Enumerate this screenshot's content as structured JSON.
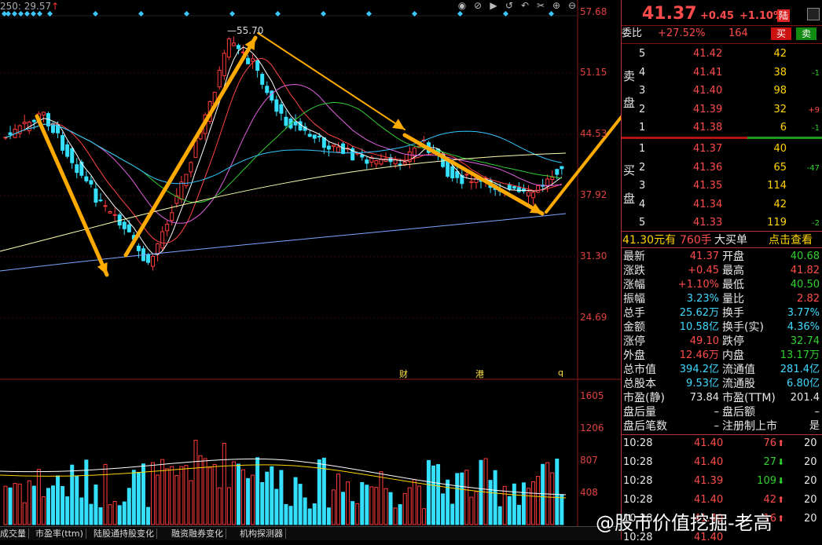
{
  "chart_header": {
    "ma_text": "250: 29.57",
    "peak_label": "55.70"
  },
  "price_axis": [
    "57.68",
    "51.15",
    "44.53",
    "37.92",
    "31.30",
    "24.69"
  ],
  "volume_axis": [
    "1605",
    "1206",
    "807",
    "408"
  ],
  "event_markers": [
    "财",
    "港",
    "q"
  ],
  "toolbar_icons": [
    "eye-icon",
    "eye-slash-icon",
    "play-icon",
    "replay-icon",
    "undo-icon",
    "settings-icon",
    "zoom-in-icon",
    "zoom-out-icon"
  ],
  "bottom_tabs": [
    "成交量",
    "市盈率(ttm)",
    "陆股通持股变化",
    "融资融券变化",
    "机构探测器"
  ],
  "watermark": "@股市价值挖掘-老高",
  "colors": {
    "up": "#ff3b3b",
    "down": "#35e0ff",
    "bg": "#000000",
    "arrow": "#ffaa00"
  },
  "quote": {
    "price": "41.37",
    "change": "+0.45",
    "change_pct": "+1.10%",
    "tag": "陆",
    "weibi_label": "委比",
    "weibi_value": "+27.52%",
    "weicha": "164",
    "sell_button": "买",
    "buy_button": "卖",
    "sell_side_label": [
      "卖",
      "盘"
    ],
    "buy_side_label": [
      "买",
      "盘"
    ],
    "asks": [
      {
        "level": "5",
        "price": "41.42",
        "vol": "42",
        "delta": ""
      },
      {
        "level": "4",
        "price": "41.41",
        "vol": "38",
        "delta": "-1"
      },
      {
        "level": "3",
        "price": "41.40",
        "vol": "98",
        "delta": ""
      },
      {
        "level": "2",
        "price": "41.39",
        "vol": "32",
        "delta": "+9"
      },
      {
        "level": "1",
        "price": "41.38",
        "vol": "6",
        "delta": "-1"
      }
    ],
    "bids": [
      {
        "level": "1",
        "price": "41.37",
        "vol": "40",
        "delta": ""
      },
      {
        "level": "2",
        "price": "41.36",
        "vol": "65",
        "delta": "-47"
      },
      {
        "level": "3",
        "price": "41.35",
        "vol": "114",
        "delta": ""
      },
      {
        "level": "4",
        "price": "41.34",
        "vol": "42",
        "delta": ""
      },
      {
        "level": "5",
        "price": "41.33",
        "vol": "119",
        "delta": "-2"
      }
    ],
    "big_order": {
      "price": "41.30元有",
      "qty": "760手",
      "label": "大买单",
      "link": "点击查看"
    },
    "stats": [
      {
        "l1": "最新",
        "v1": "41.37",
        "c1": "red",
        "l2": "开盘",
        "v2": "40.68",
        "c2": "green"
      },
      {
        "l1": "涨跌",
        "v1": "+0.45",
        "c1": "red",
        "l2": "最高",
        "v2": "41.82",
        "c2": "red"
      },
      {
        "l1": "涨幅",
        "v1": "+1.10%",
        "c1": "red",
        "l2": "最低",
        "v2": "40.50",
        "c2": "green"
      },
      {
        "l1": "振幅",
        "v1": "3.23%",
        "c1": "cyan",
        "l2": "量比",
        "v2": "2.82",
        "c2": "red"
      },
      {
        "l1": "总手",
        "v1": "25.62万",
        "c1": "cyan",
        "l2": "换手",
        "v2": "3.77%",
        "c2": "cyan"
      },
      {
        "l1": "金额",
        "v1": "10.58亿",
        "c1": "cyan",
        "l2": "换手(实)",
        "v2": "4.36%",
        "c2": "cyan"
      },
      {
        "l1": "涨停",
        "v1": "49.10",
        "c1": "red",
        "l2": "跌停",
        "v2": "32.74",
        "c2": "green"
      },
      {
        "l1": "外盘",
        "v1": "12.46万",
        "c1": "red",
        "l2": "内盘",
        "v2": "13.17万",
        "c2": "green"
      },
      {
        "l1": "总市值",
        "v1": "394.2亿",
        "c1": "cyan",
        "l2": "流通值",
        "v2": "281.4亿",
        "c2": "cyan"
      },
      {
        "l1": "总股本",
        "v1": "9.53亿",
        "c1": "cyan",
        "l2": "流通股",
        "v2": "6.80亿",
        "c2": "cyan"
      },
      {
        "l1": "市盈(静)",
        "v1": "73.84",
        "c1": "white",
        "l2": "市盈(TTM)",
        "v2": "201.4",
        "c2": "white"
      },
      {
        "l1": "盘后量",
        "v1": "–",
        "c1": "white",
        "l2": "盘后额",
        "v2": "–",
        "c2": "white"
      },
      {
        "l1": "盘后笔数",
        "v1": "–",
        "c1": "white",
        "l2": "注册制上市",
        "v2": "是",
        "c2": "white"
      }
    ],
    "ticks": [
      {
        "time": "10:28",
        "price": "41.40",
        "vol": "76",
        "dir": "up",
        "cnt": "20"
      },
      {
        "time": "10:28",
        "price": "41.40",
        "vol": "27",
        "dir": "down",
        "cnt": "20"
      },
      {
        "time": "10:28",
        "price": "41.39",
        "vol": "109",
        "dir": "down",
        "cnt": "20"
      },
      {
        "time": "10:28",
        "price": "41.40",
        "vol": "42",
        "dir": "up",
        "cnt": "20"
      },
      {
        "time": "10:28",
        "price": "41.40",
        "vol": "16",
        "dir": "up",
        "cnt": "20"
      },
      {
        "time": "10:28",
        "price": "41.40",
        "vol": "",
        "dir": "up",
        "cnt": ""
      }
    ]
  }
}
